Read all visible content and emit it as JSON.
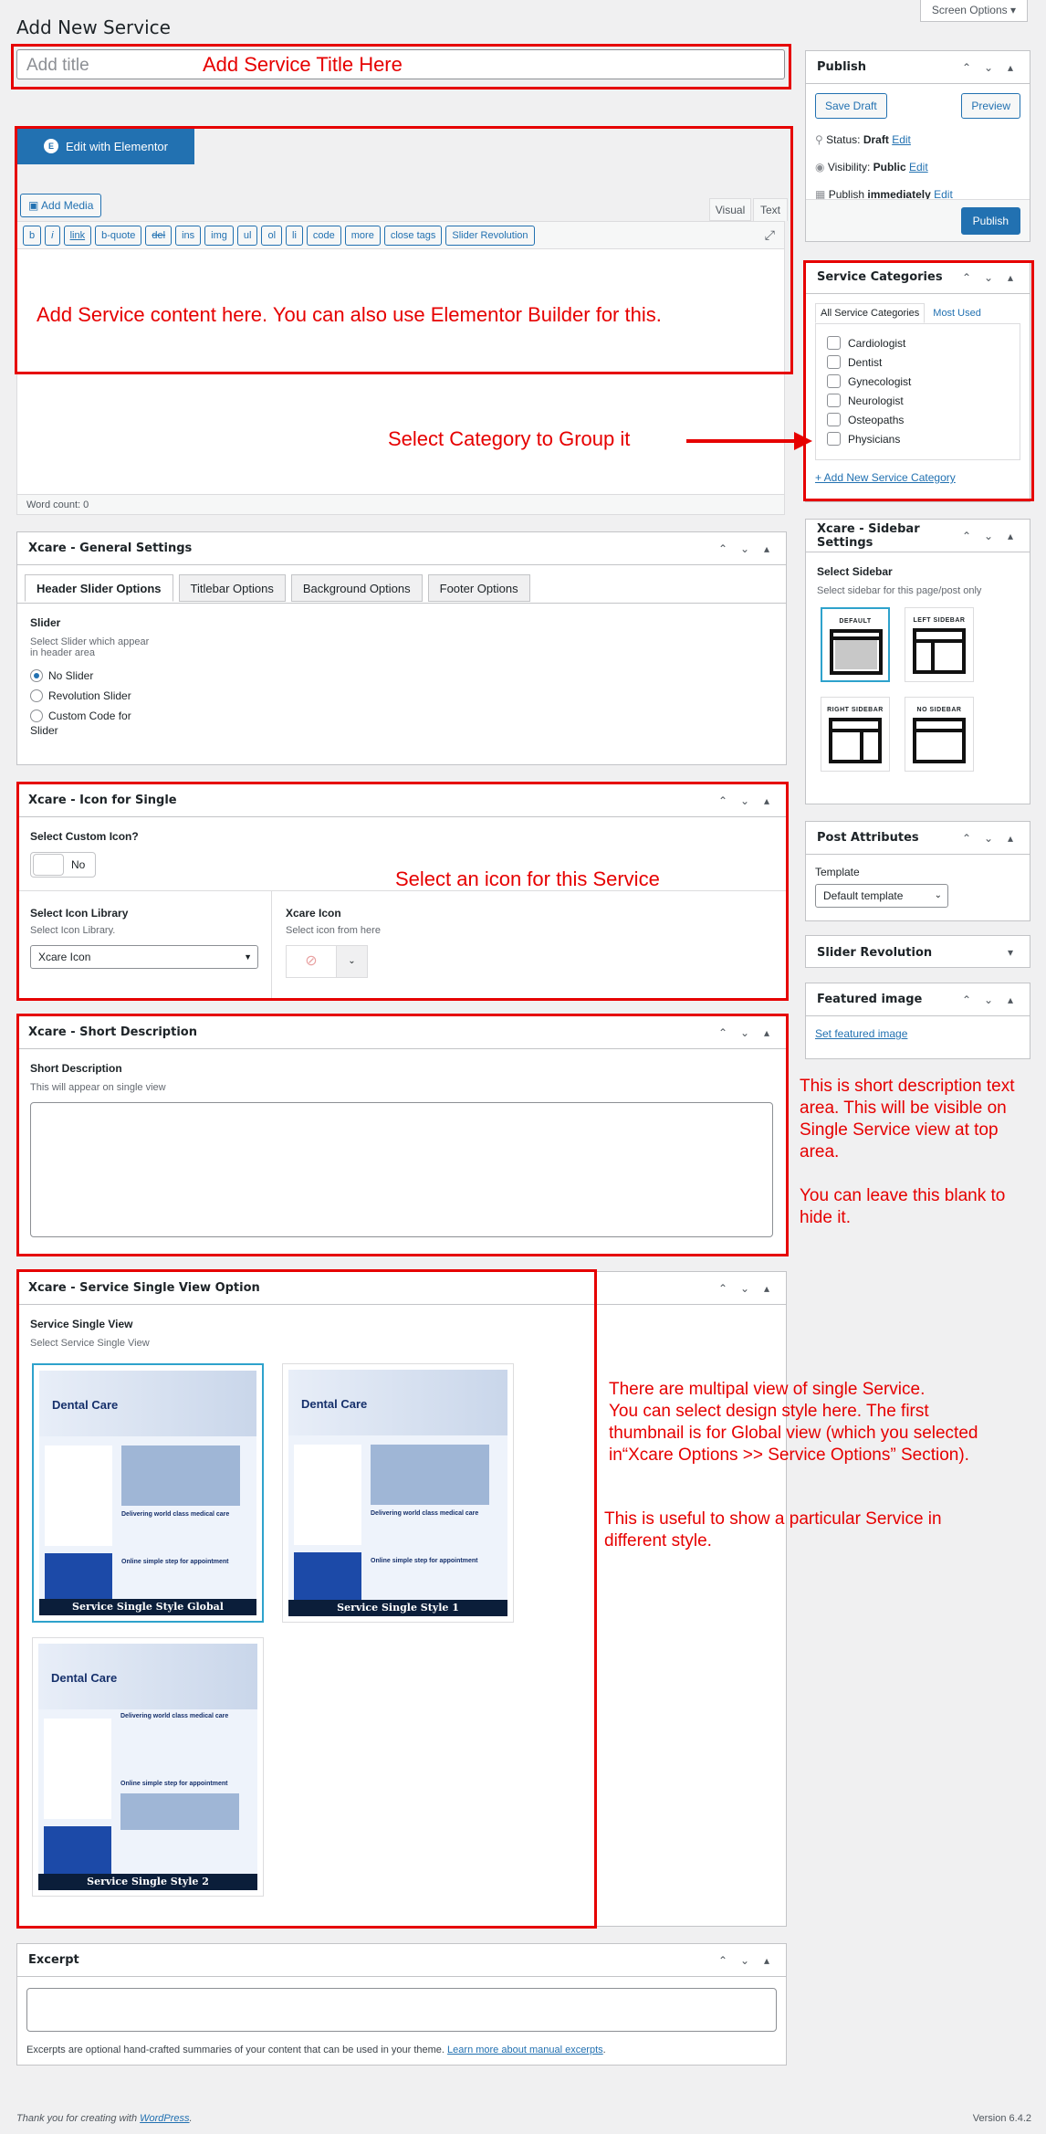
{
  "page": {
    "title": "Add New Service",
    "screen_options": "Screen Options"
  },
  "title_input": {
    "placeholder": "Add title"
  },
  "editor": {
    "elementor_btn": "Edit with Elementor",
    "add_media": "Add Media",
    "tab_visual": "Visual",
    "tab_text": "Text",
    "quicktags": [
      "b",
      "i",
      "link",
      "b-quote",
      "del",
      "ins",
      "img",
      "ul",
      "ol",
      "li",
      "code",
      "more",
      "close tags",
      "Slider Revolution"
    ],
    "word_count": "Word count: 0"
  },
  "general_settings": {
    "title": "Xcare - General Settings",
    "tabs": [
      "Header Slider Options",
      "Titlebar Options",
      "Background Options",
      "Footer Options"
    ],
    "slider_label": "Slider",
    "slider_desc1": "Select Slider which appear",
    "slider_desc2": "in header area",
    "options": [
      "No Slider",
      "Revolution Slider",
      "Custom Code for"
    ],
    "option_wrap": "Slider"
  },
  "icon_single": {
    "title": "Xcare - Icon for Single",
    "custom_icon_label": "Select Custom Icon?",
    "toggle": "No",
    "lib_label": "Select Icon Library",
    "lib_desc": "Select Icon Library.",
    "lib_value": "Xcare Icon",
    "icon_label": "Xcare Icon",
    "icon_desc": "Select icon from here"
  },
  "short_desc": {
    "title": "Xcare - Short Description",
    "label": "Short Description",
    "desc": "This will appear on single view"
  },
  "single_view": {
    "title": "Xcare - Service Single View Option",
    "label": "Service Single View",
    "desc": "Select Service Single View",
    "thumbs": [
      "Service Single Style Global",
      "Service Single Style 1",
      "Service Single Style 2"
    ],
    "thumb_heading": "Dental Care",
    "thumb_line": "Delivering world class medical care",
    "thumb_line2": "Online simple step for appointment"
  },
  "excerpt": {
    "title": "Excerpt",
    "note": "Excerpts are optional hand-crafted summaries of your content that can be used in your theme.",
    "link": "Learn more about manual excerpts"
  },
  "publish": {
    "title": "Publish",
    "save_draft": "Save Draft",
    "preview": "Preview",
    "status_label": "Status:",
    "status": "Draft",
    "visibility_label": "Visibility:",
    "visibility": "Public",
    "publish_label": "Publish",
    "publish_when": "immediately",
    "edit": "Edit",
    "publish_btn": "Publish"
  },
  "categories": {
    "title": "Service Categories",
    "tab_all": "All Service Categories",
    "tab_used": "Most Used",
    "items": [
      "Cardiologist",
      "Dentist",
      "Gynecologist",
      "Neurologist",
      "Osteopaths",
      "Physicians"
    ],
    "add_new": "+ Add New Service Category"
  },
  "sidebar_settings": {
    "title": "Xcare - Sidebar Settings",
    "label": "Select Sidebar",
    "desc": "Select sidebar for this page/post only",
    "options": [
      "DEFAULT",
      "LEFT SIDEBAR",
      "RIGHT SIDEBAR",
      "NO SIDEBAR"
    ]
  },
  "post_attributes": {
    "title": "Post Attributes",
    "template_label": "Template",
    "template_value": "Default template"
  },
  "slider_revolution": {
    "title": "Slider Revolution"
  },
  "featured_image": {
    "title": "Featured image",
    "link": "Set featured image"
  },
  "annotations": {
    "title": "Add Service Title Here",
    "content": "Add Service content here. You can also use Elementor Builder for this.",
    "category": "Select Category to Group it",
    "icon": "Select an icon for this Service",
    "short1": "This is short description text",
    "short2": "area. This will be visible on",
    "short3": "Single Service view at top",
    "short4": "area.",
    "short5": "You can leave this blank to",
    "short6": "hide it.",
    "view1": "There are multipal view of single Service.",
    "view2": "You can select design style here. The first",
    "view3": "thumbnail is for Global view (which you selected",
    "view4": "in“Xcare Options >> Service Options” Section).",
    "view5": "This is useful to show a particular Service in",
    "view6": "different style."
  },
  "footer": {
    "thanks": "Thank you for creating with",
    "wp": "WordPress",
    "version": "Version 6.4.2"
  }
}
